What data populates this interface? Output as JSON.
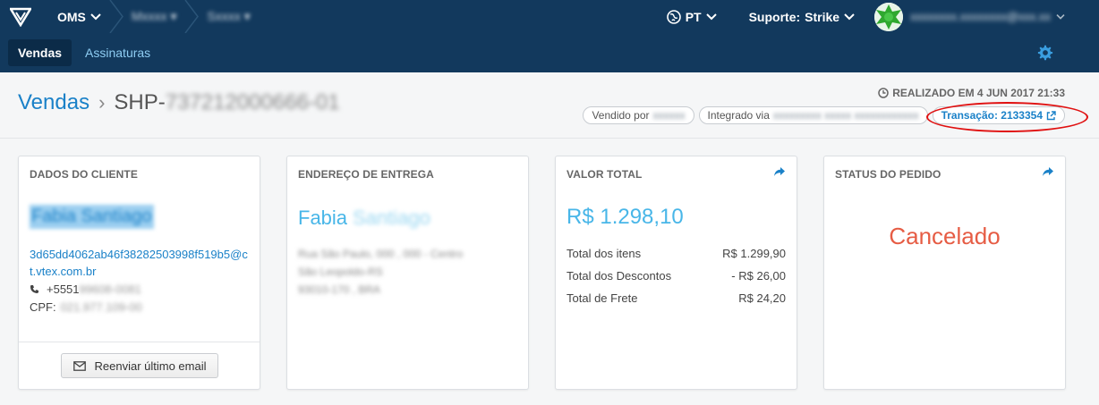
{
  "topbar": {
    "app": "OMS",
    "crumb1": "Mxxxx ▾",
    "crumb2": "Sxxxx ▾",
    "language": "PT",
    "support_label": "Suporte:",
    "support_value": "Strike",
    "user_email": "xxxxxxxx.xxxxxxxx@xxx.xx"
  },
  "subnav": {
    "tabs": [
      "Vendas",
      "Assinaturas"
    ]
  },
  "header": {
    "breadcrumb_link": "Vendas",
    "order_prefix": "SHP-",
    "order_rest": "737212000666-01",
    "realizado": "REALIZADO EM 4 JUN 2017 21:33",
    "vendido_label": "Vendido por",
    "vendido_value": "xxxxxx",
    "integrado_label": "Integrado via",
    "integrado_value": "xxxxxxxxx xxxxx xxxxxxxxxxxx",
    "transacao": "Transação: 2133354"
  },
  "cards": {
    "cliente": {
      "title": "DADOS DO CLIENTE",
      "name": "Fabia Santiago",
      "email": "3d65dd4062ab46f38282503998f519b5@ct.vtex.com.br",
      "phone_prefix": "+5551",
      "phone_rest": "99608-0081",
      "cpf_label": "CPF:",
      "cpf_value": "021.977.109-00",
      "resend_label": "Reenviar último email"
    },
    "entrega": {
      "title": "ENDEREÇO DE ENTREGA",
      "first_name": "Fabia",
      "last_name": "Santiago",
      "line1": "Rua São Paulo, 000 , 000 - Centro",
      "line2": "São Leopoldo-RS",
      "line3": "93010-170 , BRA"
    },
    "valor": {
      "title": "VALOR TOTAL",
      "total": "R$ 1.298,10",
      "rows": [
        {
          "label": "Total dos itens",
          "value": "R$ 1.299,90"
        },
        {
          "label": "Total dos Descontos",
          "value": "- R$ 26,00"
        },
        {
          "label": "Total de Frete",
          "value": "R$ 24,20"
        }
      ]
    },
    "status": {
      "title": "STATUS DO PEDIDO",
      "value": "Cancelado"
    }
  },
  "colors": {
    "topbar": "#12395d",
    "accent": "#1a81c8",
    "status_cancel": "#e65c44",
    "highlight_circle": "#e01010"
  }
}
